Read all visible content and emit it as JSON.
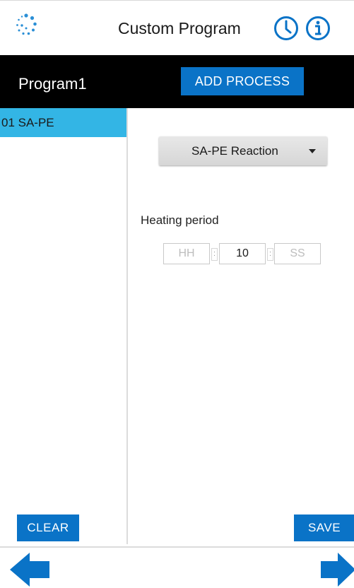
{
  "header": {
    "title": "Custom Program",
    "logo_icon": "app-logo-dots-icon",
    "clock_icon": "clock-icon",
    "info_icon": "info-icon",
    "accent_color": "#0a73c7"
  },
  "program": {
    "name": "Program1",
    "add_process_label": "ADD PROCESS"
  },
  "process_list": {
    "items": [
      {
        "label": "01 SA-PE",
        "selected": true
      }
    ],
    "selected_color": "#33b5e5"
  },
  "process_detail": {
    "type_selected": "SA-PE Reaction",
    "heating_period_label": "Heating period",
    "heating_period": {
      "hours_placeholder": "HH",
      "minutes_value": "10",
      "seconds_placeholder": "SS",
      "separator": ":"
    }
  },
  "actions": {
    "clear_label": "CLEAR",
    "save_label": "SAVE"
  },
  "navigation": {
    "back_icon": "arrow-left-icon",
    "forward_icon": "arrow-right-icon"
  }
}
